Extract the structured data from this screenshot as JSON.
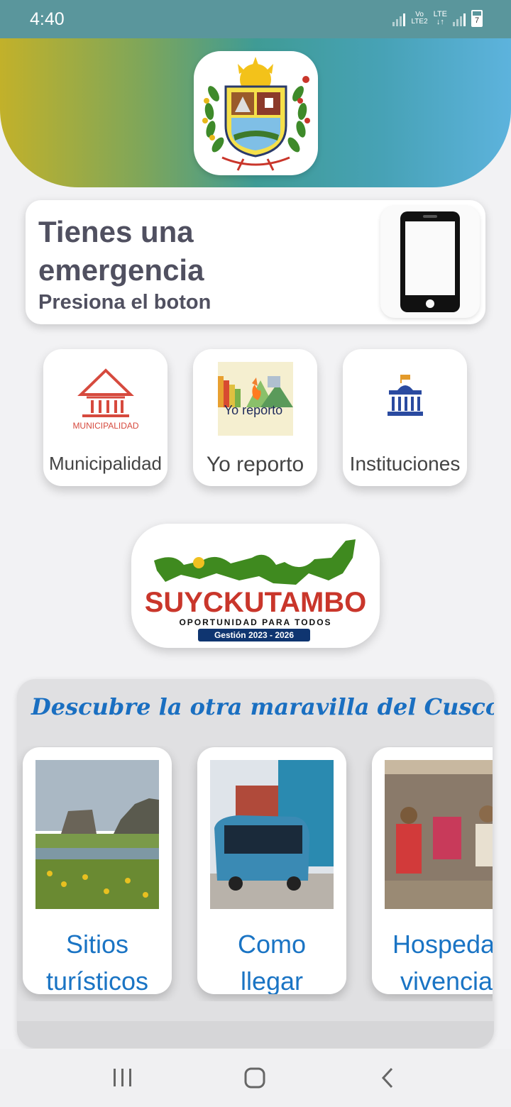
{
  "status_bar": {
    "time": "4:40",
    "net_label_1": "Vo",
    "net_label_2": "LTE2",
    "net_label_3": "LTE",
    "battery_level": "7"
  },
  "header": {
    "crest_icon": "municipal-coat-of-arms"
  },
  "emergency": {
    "title": "Tienes una emergencia",
    "subtitle": "Presiona el boton",
    "icon": "smartphone-icon"
  },
  "tiles": [
    {
      "label": "Municipalidad",
      "image_caption": "MUNICIPALIDAD",
      "icon": "municipal-building-icon"
    },
    {
      "label": "Yo reporto",
      "image_caption": "Yo reporto",
      "icon": "report-icon"
    },
    {
      "label": "Instituciones",
      "icon": "government-building-icon"
    }
  ],
  "logo": {
    "name": "SUYCKUTAMBO",
    "slogan": "OPORTUNIDAD PARA TODOS",
    "term": "Gestión 2023 - 2026"
  },
  "discover": {
    "title": "Descubre la otra maravilla del Cusco",
    "cards": [
      {
        "label": "Sitios\nturísticos"
      },
      {
        "label": "Como\nllegar"
      },
      {
        "label": "Hospedaj\nvivencia"
      }
    ]
  },
  "nav": {
    "recents": "recents-icon",
    "home": "home-icon",
    "back": "back-icon"
  },
  "colors": {
    "accent_blue": "#1a74c4",
    "status_bar": "#5a969c",
    "logo_green": "#3f8a1f",
    "logo_navy": "#0f3570"
  }
}
